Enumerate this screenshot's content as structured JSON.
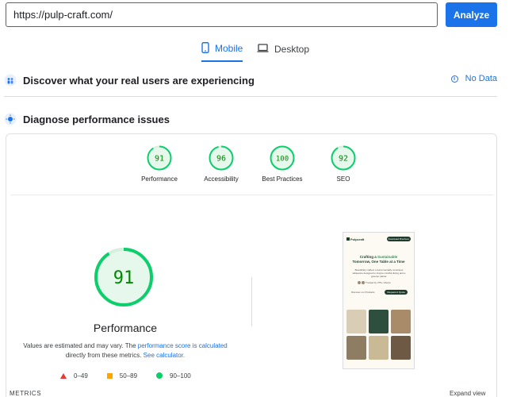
{
  "url_bar": {
    "value": "https://pulp-craft.com/",
    "analyze_label": "Analyze"
  },
  "tabs": [
    {
      "label": "Mobile",
      "icon": "smartphone-icon",
      "active": true
    },
    {
      "label": "Desktop",
      "icon": "laptop-icon",
      "active": false
    }
  ],
  "field_data": {
    "title": "Discover what your real users are experiencing",
    "status": "No Data",
    "icon": "users-icon"
  },
  "lab_data": {
    "title": "Diagnose performance issues",
    "icon": "lighthouse-icon"
  },
  "gauges": [
    {
      "score": "91",
      "label": "Performance"
    },
    {
      "score": "96",
      "label": "Accessibility"
    },
    {
      "score": "100",
      "label": "Best Practices"
    },
    {
      "score": "92",
      "label": "SEO"
    }
  ],
  "performance": {
    "score": "91",
    "title": "Performance",
    "note_prefix": "Values are estimated and may vary. The",
    "note_link1": "performance score is calculated",
    "note_middle": "directly from these metrics.",
    "note_link2": "See calculator."
  },
  "legend": [
    {
      "range": "0–49",
      "color": "#e53935",
      "shape": "triangle"
    },
    {
      "range": "50–89",
      "color": "#ffa400",
      "shape": "square"
    },
    {
      "range": "90–100",
      "color": "#0cce6b",
      "shape": "circle"
    }
  ],
  "preview": {
    "brand": "Pulpcraft",
    "nav_button": "Download Brochure",
    "headline_1": "Crafting a",
    "headline_accent": "Sustainable",
    "headline_2": "Tomorrow, One Table at a Time",
    "subtext": "Beautifully crafted, environmentally conscious tableware designed to inspire mindful dining and a greener planet.",
    "trust": "Trusted by 375+ Clients",
    "discover": "Discover our Products",
    "cta": "Request A Quote"
  },
  "metrics_label": "METRICS",
  "expand_label": "Expand view",
  "colors": {
    "accent": "#1a73e8",
    "pass": "#0cce6b",
    "pass_text": "#008800",
    "pass_fill": "#e6f7ec"
  }
}
